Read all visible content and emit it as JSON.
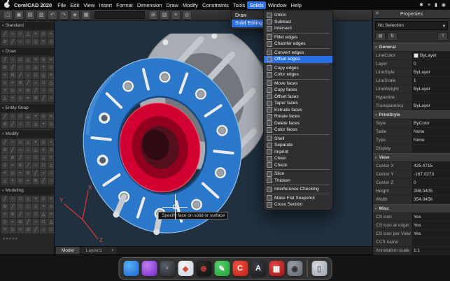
{
  "colors": {
    "accent_blue": "#2a6fe3",
    "canvas_bg": "#20303e",
    "ring_blue": "#2b77c9",
    "hub_red": "#d10030",
    "steel_gray": "#a7adb3"
  },
  "menubar": {
    "app_name": "CorelCAD 2020",
    "items": [
      "File",
      "Edit",
      "View",
      "Insert",
      "Format",
      "Dimension",
      "Draw",
      "Modify",
      "Constraints",
      "Tools",
      "Solids",
      "Window",
      "Help"
    ],
    "active_item": "Solids",
    "status_icons": [
      "display-icon",
      "control-center-icon",
      "battery-icon",
      "clock-icon"
    ]
  },
  "toolbar": {
    "icon_names": [
      "new-icon",
      "open-icon",
      "save-icon",
      "print-icon",
      "undo-icon",
      "redo-icon",
      "copy-icon",
      "paste-icon",
      "zoom-icon",
      "pan-icon",
      "layers-icon",
      "settings-icon"
    ]
  },
  "left_toolbar": {
    "sections": [
      {
        "label": "Standard",
        "rows": 2
      },
      {
        "label": "Draw",
        "rows": 6
      },
      {
        "label": "Entity Snap",
        "rows": 2
      },
      {
        "label": "Modify",
        "rows": 6
      },
      {
        "label": "Modeling",
        "rows": 5
      }
    ],
    "collapse_label": "«««««"
  },
  "solids_menu": {
    "items": [
      {
        "label": "Draw",
        "has_submenu": true,
        "highlighted": false
      },
      {
        "label": "Solid Editing",
        "has_submenu": true,
        "highlighted": true
      }
    ]
  },
  "solid_editing_submenu": {
    "groups": [
      [
        "Union",
        "Subtract",
        "Intersect"
      ],
      [
        "Fillet edges",
        "Chamfer edges"
      ],
      [
        "Convert edges",
        "Offset edges"
      ],
      [
        "Copy edges",
        "Color edges"
      ],
      [
        "Move faces",
        "Copy faces",
        "Offset faces",
        "Taper faces",
        "Extrude faces",
        "Rotate faces",
        "Delete faces",
        "Color faces"
      ],
      [
        "Shell",
        "Separate",
        "Imprint",
        "Clean",
        "Check"
      ],
      [
        "Slice",
        "Thicken"
      ],
      [
        "Interference Checking"
      ],
      [
        "Make Flat Snapshot",
        "Cross Section"
      ]
    ],
    "highlighted_item": "Offset edges"
  },
  "canvas": {
    "tooltip": "Specify face on solid or surface",
    "axes": [
      "X",
      "Y",
      "Z"
    ]
  },
  "tabs": {
    "items": [
      "Model",
      "Layout1"
    ],
    "active": "Model",
    "add_button": "+"
  },
  "properties": {
    "title": "Properties",
    "close_glyph": "✕",
    "selection_value": "No Selection",
    "dropdown_arrow": "▾",
    "toolbar_icons": [
      "categorized-icon",
      "sort-icon",
      "help-icon"
    ],
    "help_glyph": "?",
    "sections": [
      {
        "label": "General",
        "rows": [
          {
            "label": "LineColor",
            "value": "ByLayer",
            "swatch": "#e8e8e8"
          },
          {
            "label": "Layer",
            "value": "0"
          },
          {
            "label": "LineStyle",
            "value": "ByLayer"
          },
          {
            "label": "LineScale",
            "value": "1"
          },
          {
            "label": "LineWeight",
            "value": "ByLayer"
          },
          {
            "label": "Hyperlink",
            "value": ""
          },
          {
            "label": "Transparency",
            "value": "ByLayer"
          }
        ]
      },
      {
        "label": "PrintStyle",
        "rows": [
          {
            "label": "Style",
            "value": "ByColor"
          },
          {
            "label": "Table",
            "value": "None"
          },
          {
            "label": "Type",
            "value": "None"
          },
          {
            "label": "Display",
            "value": ""
          }
        ]
      },
      {
        "label": "View",
        "rows": [
          {
            "label": "Center X",
            "value": "425.4715"
          },
          {
            "label": "Center Y",
            "value": "-167.0273"
          },
          {
            "label": "Center Z",
            "value": "0"
          },
          {
            "label": "Height",
            "value": "288.0405"
          },
          {
            "label": "Width",
            "value": "354.0456"
          }
        ]
      },
      {
        "label": "Misc",
        "rows": [
          {
            "label": "CS icon",
            "value": "Yes"
          },
          {
            "label": "CS icon at origin",
            "value": "Yes"
          },
          {
            "label": "CS icon per View",
            "value": "Yes"
          },
          {
            "label": "CCS name",
            "value": ""
          },
          {
            "label": "Annotation scale",
            "value": "1:1"
          }
        ]
      }
    ]
  },
  "dock": {
    "icons": [
      {
        "name": "dock-icon-finder",
        "c1": "#59b2f6",
        "c2": "#1e63d4",
        "glyph": ""
      },
      {
        "name": "dock-icon-purple-sphere",
        "c1": "#c07df0",
        "c2": "#7426c9",
        "glyph": ""
      },
      {
        "name": "dock-icon-dark-sphere",
        "c1": "#5a5f66",
        "c2": "#23262b",
        "glyph": "◦",
        "glyph_color": "#d8dbde"
      },
      {
        "name": "dock-icon-safari",
        "c1": "#f4f6f8",
        "c2": "#c9d2da",
        "glyph": "◆",
        "glyph_color": "#d84a3a"
      },
      {
        "name": "dock-icon-corelcad",
        "c1": "#2b2b2b",
        "c2": "#111111",
        "glyph": "⊕",
        "glyph_color": "#e23c3c"
      },
      {
        "name": "dock-icon-green-design",
        "c1": "#57d06a",
        "c2": "#1f9e38",
        "glyph": "✎"
      },
      {
        "name": "dock-icon-c-red",
        "c1": "#f0513c",
        "c2": "#c01f17",
        "glyph": "C"
      },
      {
        "name": "dock-icon-a-dark",
        "c1": "#3a3f45",
        "c2": "#17191c",
        "glyph": "A"
      },
      {
        "name": "dock-icon-red",
        "c1": "#e04545",
        "c2": "#a31212",
        "glyph": "▦"
      },
      {
        "name": "dock-icon-camera",
        "c1": "#9aa1a8",
        "c2": "#5c6268",
        "glyph": "◉",
        "glyph_color": "#2c2f33"
      },
      {
        "name": "dock-icon-trash",
        "c1": "#d7dade",
        "c2": "#9ba1a7",
        "glyph": "▯",
        "glyph_color": "#6a7077"
      }
    ]
  }
}
